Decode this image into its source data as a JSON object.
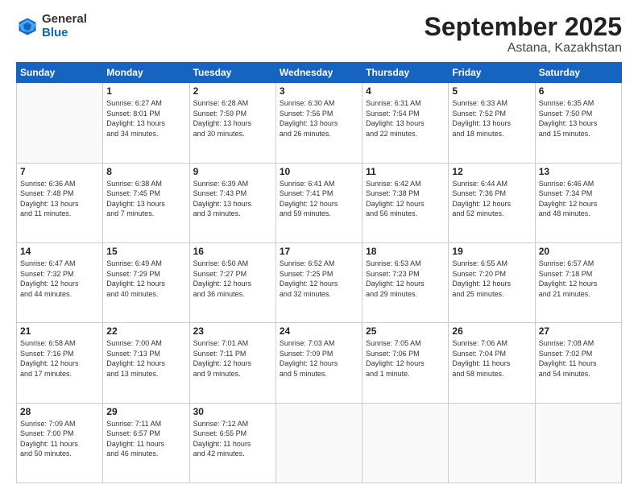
{
  "logo": {
    "general": "General",
    "blue": "Blue"
  },
  "title": {
    "month": "September 2025",
    "location": "Astana, Kazakhstan"
  },
  "weekdays": [
    "Sunday",
    "Monday",
    "Tuesday",
    "Wednesday",
    "Thursday",
    "Friday",
    "Saturday"
  ],
  "weeks": [
    [
      {
        "day": "",
        "info": ""
      },
      {
        "day": "1",
        "info": "Sunrise: 6:27 AM\nSunset: 8:01 PM\nDaylight: 13 hours\nand 34 minutes."
      },
      {
        "day": "2",
        "info": "Sunrise: 6:28 AM\nSunset: 7:59 PM\nDaylight: 13 hours\nand 30 minutes."
      },
      {
        "day": "3",
        "info": "Sunrise: 6:30 AM\nSunset: 7:56 PM\nDaylight: 13 hours\nand 26 minutes."
      },
      {
        "day": "4",
        "info": "Sunrise: 6:31 AM\nSunset: 7:54 PM\nDaylight: 13 hours\nand 22 minutes."
      },
      {
        "day": "5",
        "info": "Sunrise: 6:33 AM\nSunset: 7:52 PM\nDaylight: 13 hours\nand 18 minutes."
      },
      {
        "day": "6",
        "info": "Sunrise: 6:35 AM\nSunset: 7:50 PM\nDaylight: 13 hours\nand 15 minutes."
      }
    ],
    [
      {
        "day": "7",
        "info": "Sunrise: 6:36 AM\nSunset: 7:48 PM\nDaylight: 13 hours\nand 11 minutes."
      },
      {
        "day": "8",
        "info": "Sunrise: 6:38 AM\nSunset: 7:45 PM\nDaylight: 13 hours\nand 7 minutes."
      },
      {
        "day": "9",
        "info": "Sunrise: 6:39 AM\nSunset: 7:43 PM\nDaylight: 13 hours\nand 3 minutes."
      },
      {
        "day": "10",
        "info": "Sunrise: 6:41 AM\nSunset: 7:41 PM\nDaylight: 12 hours\nand 59 minutes."
      },
      {
        "day": "11",
        "info": "Sunrise: 6:42 AM\nSunset: 7:38 PM\nDaylight: 12 hours\nand 56 minutes."
      },
      {
        "day": "12",
        "info": "Sunrise: 6:44 AM\nSunset: 7:36 PM\nDaylight: 12 hours\nand 52 minutes."
      },
      {
        "day": "13",
        "info": "Sunrise: 6:46 AM\nSunset: 7:34 PM\nDaylight: 12 hours\nand 48 minutes."
      }
    ],
    [
      {
        "day": "14",
        "info": "Sunrise: 6:47 AM\nSunset: 7:32 PM\nDaylight: 12 hours\nand 44 minutes."
      },
      {
        "day": "15",
        "info": "Sunrise: 6:49 AM\nSunset: 7:29 PM\nDaylight: 12 hours\nand 40 minutes."
      },
      {
        "day": "16",
        "info": "Sunrise: 6:50 AM\nSunset: 7:27 PM\nDaylight: 12 hours\nand 36 minutes."
      },
      {
        "day": "17",
        "info": "Sunrise: 6:52 AM\nSunset: 7:25 PM\nDaylight: 12 hours\nand 32 minutes."
      },
      {
        "day": "18",
        "info": "Sunrise: 6:53 AM\nSunset: 7:23 PM\nDaylight: 12 hours\nand 29 minutes."
      },
      {
        "day": "19",
        "info": "Sunrise: 6:55 AM\nSunset: 7:20 PM\nDaylight: 12 hours\nand 25 minutes."
      },
      {
        "day": "20",
        "info": "Sunrise: 6:57 AM\nSunset: 7:18 PM\nDaylight: 12 hours\nand 21 minutes."
      }
    ],
    [
      {
        "day": "21",
        "info": "Sunrise: 6:58 AM\nSunset: 7:16 PM\nDaylight: 12 hours\nand 17 minutes."
      },
      {
        "day": "22",
        "info": "Sunrise: 7:00 AM\nSunset: 7:13 PM\nDaylight: 12 hours\nand 13 minutes."
      },
      {
        "day": "23",
        "info": "Sunrise: 7:01 AM\nSunset: 7:11 PM\nDaylight: 12 hours\nand 9 minutes."
      },
      {
        "day": "24",
        "info": "Sunrise: 7:03 AM\nSunset: 7:09 PM\nDaylight: 12 hours\nand 5 minutes."
      },
      {
        "day": "25",
        "info": "Sunrise: 7:05 AM\nSunset: 7:06 PM\nDaylight: 12 hours\nand 1 minute."
      },
      {
        "day": "26",
        "info": "Sunrise: 7:06 AM\nSunset: 7:04 PM\nDaylight: 11 hours\nand 58 minutes."
      },
      {
        "day": "27",
        "info": "Sunrise: 7:08 AM\nSunset: 7:02 PM\nDaylight: 11 hours\nand 54 minutes."
      }
    ],
    [
      {
        "day": "28",
        "info": "Sunrise: 7:09 AM\nSunset: 7:00 PM\nDaylight: 11 hours\nand 50 minutes."
      },
      {
        "day": "29",
        "info": "Sunrise: 7:11 AM\nSunset: 6:57 PM\nDaylight: 11 hours\nand 46 minutes."
      },
      {
        "day": "30",
        "info": "Sunrise: 7:12 AM\nSunset: 6:55 PM\nDaylight: 11 hours\nand 42 minutes."
      },
      {
        "day": "",
        "info": ""
      },
      {
        "day": "",
        "info": ""
      },
      {
        "day": "",
        "info": ""
      },
      {
        "day": "",
        "info": ""
      }
    ]
  ]
}
